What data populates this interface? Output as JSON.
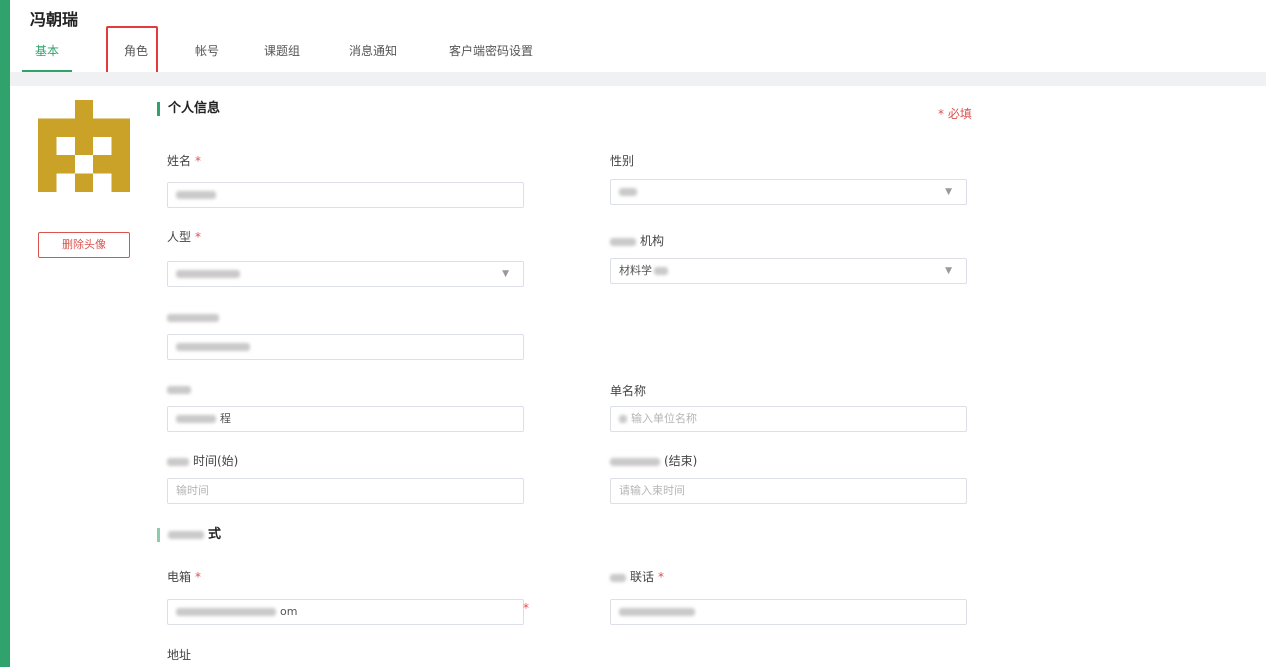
{
  "user": {
    "name": "冯朝瑞"
  },
  "tabs": [
    {
      "label": "基本",
      "active": true
    },
    {
      "label": "角色",
      "highlighted": true
    },
    {
      "label": "帐号"
    },
    {
      "label": "课题组"
    },
    {
      "label": "消息通知"
    },
    {
      "label": "客户端密码设置"
    }
  ],
  "avatar": {
    "delete_label": "删除头像",
    "colors": {
      "primary": "#c9a227",
      "secondary": "#ffffff"
    }
  },
  "personal_info": {
    "title": "个人信息",
    "required_note": "* 必填",
    "fields": {
      "name": {
        "label": "姓名",
        "value": ""
      },
      "gender": {
        "label": "性别",
        "value": ""
      },
      "person_type": {
        "label": "人型",
        "value": ""
      },
      "org": {
        "label": "机构",
        "value": "材料学"
      },
      "field5": {
        "label": "",
        "value": ""
      },
      "field6": {
        "label": "",
        "value": "程"
      },
      "unit_name": {
        "label": "单名称",
        "placeholder": "输入单位名称"
      },
      "time_start": {
        "label": "时间(始)",
        "placeholder": "输时间"
      },
      "time_end": {
        "label": "(结束)",
        "placeholder": "请输入束时间"
      }
    }
  },
  "contact": {
    "title": "式",
    "fields": {
      "email": {
        "label": "电箱",
        "value": "om"
      },
      "phone": {
        "label": "联话",
        "value": ""
      },
      "address": {
        "label": "地址"
      }
    }
  },
  "colors": {
    "accent": "#2fa36b",
    "danger": "#d9534f"
  }
}
